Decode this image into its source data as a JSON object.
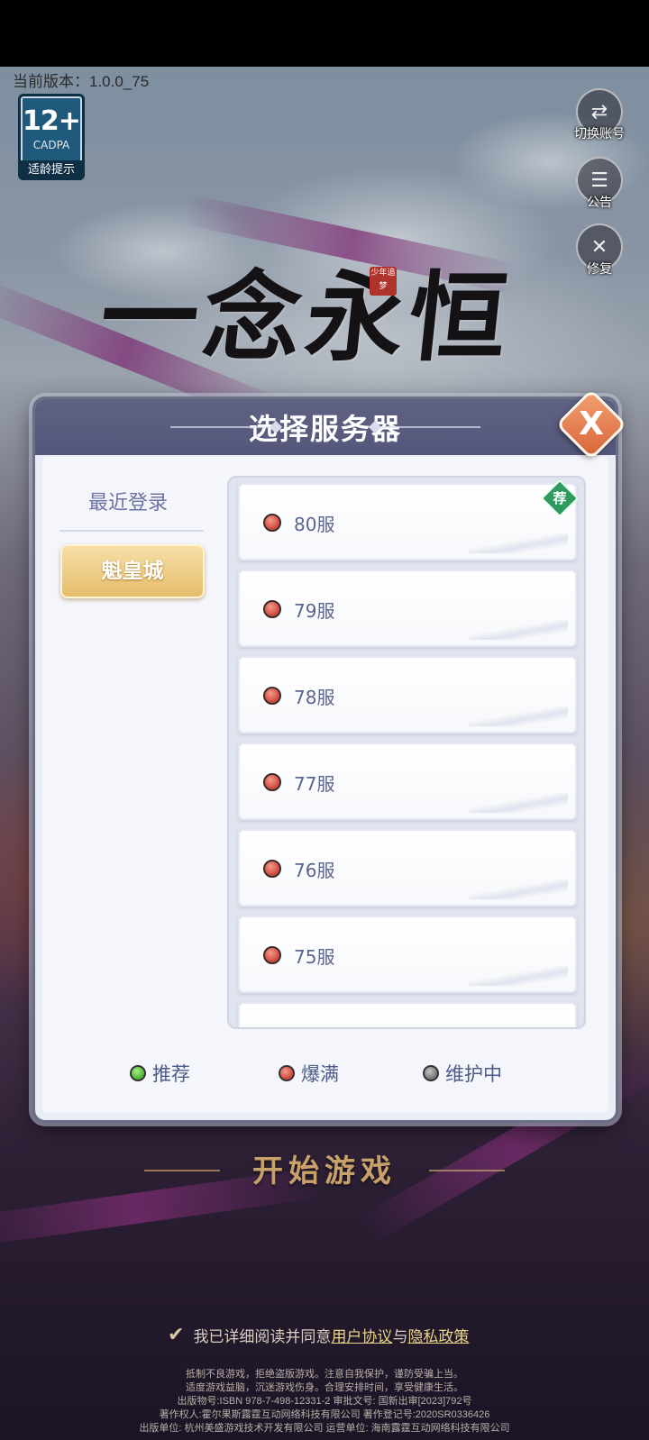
{
  "version": {
    "label": "当前版本：1.0.0_75"
  },
  "age_rating": {
    "age": "12+",
    "org": "CADPA",
    "tip": "适龄提示"
  },
  "side_buttons": [
    {
      "label": "切换账号",
      "icon": "switch-account-icon",
      "glyph": "⇄"
    },
    {
      "label": "公告",
      "icon": "announcement-icon",
      "glyph": "☰"
    },
    {
      "label": "修复",
      "icon": "repair-icon",
      "glyph": "✕"
    }
  ],
  "logo": {
    "title": "一念永恒",
    "seal": "少年追梦"
  },
  "dialog": {
    "title": "选择服务器",
    "close_label": "X",
    "recent": {
      "label": "最近登录",
      "server": "魁皇城"
    },
    "servers": [
      {
        "name": "80服",
        "status": "full",
        "badge": "荐"
      },
      {
        "name": "79服",
        "status": "full"
      },
      {
        "name": "78服",
        "status": "full"
      },
      {
        "name": "77服",
        "status": "full"
      },
      {
        "name": "76服",
        "status": "full"
      },
      {
        "name": "75服",
        "status": "full"
      }
    ],
    "legend": [
      {
        "label": "推荐",
        "color": "#4fb536"
      },
      {
        "label": "爆满",
        "color": "#d24a3c"
      },
      {
        "label": "维护中",
        "color": "#7a7a7a"
      }
    ]
  },
  "start_button": {
    "label": "开始游戏"
  },
  "agreement": {
    "prefix": "我已详细阅读并同意",
    "user_agreement": "用户协议",
    "joiner": "与",
    "privacy_policy": "隐私政策"
  },
  "footer": [
    "抵制不良游戏，拒绝盗版游戏。注意自我保护，谨防受骗上当。",
    "适度游戏益脑，沉迷游戏伤身。合理安排时间，享受健康生活。",
    "出版物号:ISBN 978-7-498-12331-2   审批文号: 国新出审[2023]792号",
    "著作权人:霍尔果斯露霆互动网络科技有限公司  著作登记号:2020SR0336426",
    "出版单位: 杭州美盛游戏技术开发有限公司  运营单位: 海南露霆互动网络科技有限公司"
  ]
}
